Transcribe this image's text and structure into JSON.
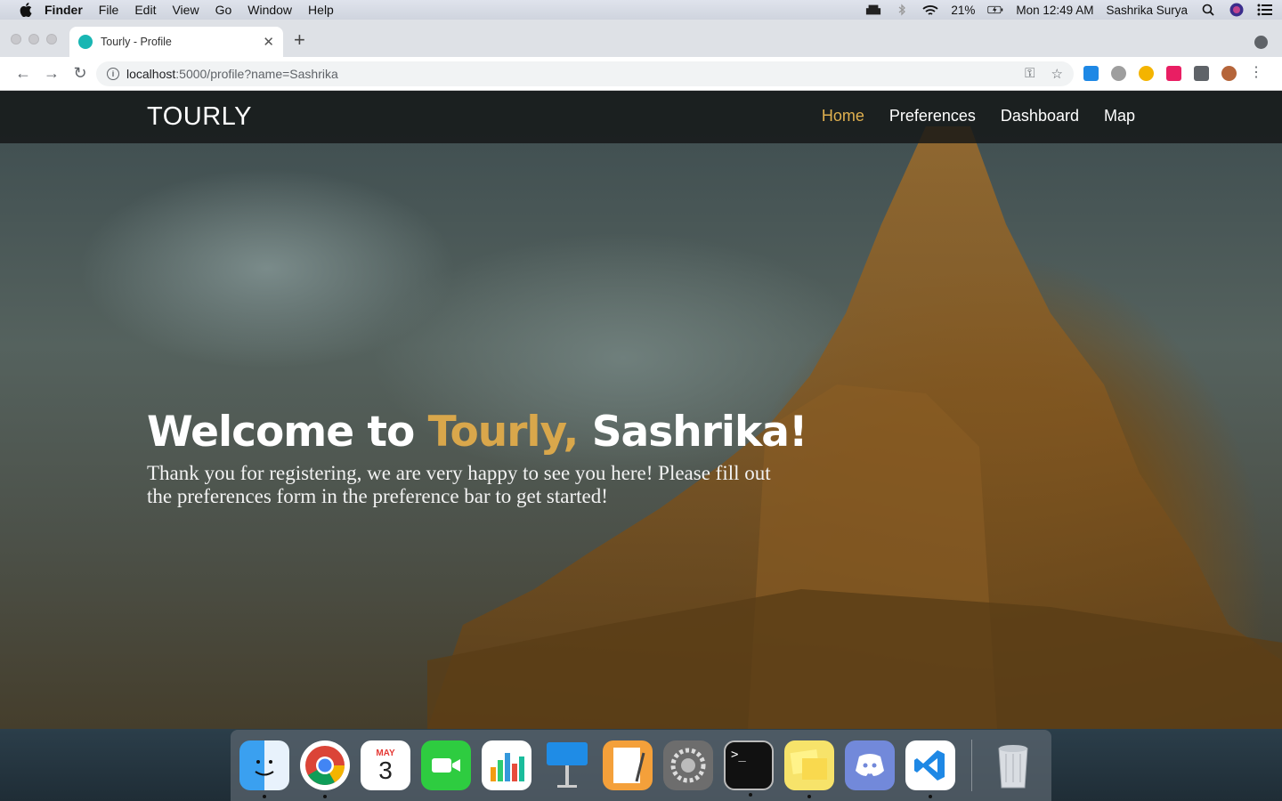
{
  "menubar": {
    "app_name": "Finder",
    "items": [
      "File",
      "Edit",
      "View",
      "Go",
      "Window",
      "Help"
    ],
    "battery": "21%",
    "clock": "Mon 12:49 AM",
    "user": "Sashrika Surya"
  },
  "browser": {
    "tab_title": "Tourly - Profile",
    "url_host": "localhost",
    "url_rest": ":5000/profile?name=Sashrika"
  },
  "site": {
    "brand": "TOURLY",
    "nav": [
      "Home",
      "Preferences",
      "Dashboard",
      "Map"
    ],
    "hero_title_pre": "Welcome to ",
    "hero_title_accent": "Tourly,",
    "hero_title_post": " Sashrika!",
    "hero_text": "Thank you for registering, we are very happy to see you here! Please fill out the preferences form in the preference bar to get started!"
  },
  "dock": {
    "calendar_month": "MAY",
    "calendar_day": "3"
  },
  "colors": {
    "accent": "#d9a74b",
    "nav_active": "#e0b04f"
  }
}
